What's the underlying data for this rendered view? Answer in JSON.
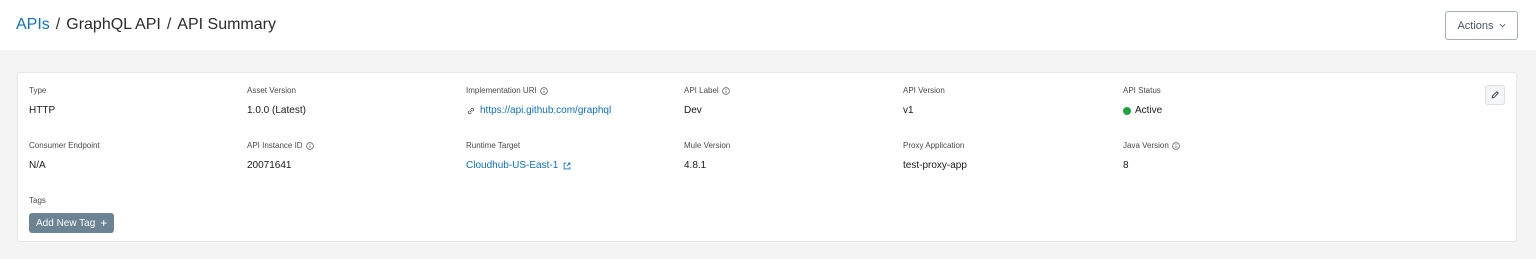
{
  "breadcrumb": {
    "root": "APIs",
    "separator": "/",
    "api": "GraphQL API",
    "page": "API Summary"
  },
  "actions": {
    "label": "Actions"
  },
  "details": {
    "type": {
      "label": "Type",
      "value": "HTTP"
    },
    "asset_version": {
      "label": "Asset Version",
      "value": "1.0.0 (Latest)"
    },
    "implementation_uri": {
      "label": "Implementation URI",
      "value": "https://api.github.com/graphql"
    },
    "api_label": {
      "label": "API Label",
      "value": "Dev"
    },
    "api_version": {
      "label": "API Version",
      "value": "v1"
    },
    "api_status": {
      "label": "API Status",
      "value": "Active",
      "color": "#23a143"
    },
    "consumer_endpoint": {
      "label": "Consumer Endpoint",
      "value": "N/A"
    },
    "api_instance_id": {
      "label": "API Instance ID",
      "value": "20071641"
    },
    "runtime_target": {
      "label": "Runtime Target",
      "value": "Cloudhub-US-East-1"
    },
    "mule_version": {
      "label": "Mule Version",
      "value": "4.8.1"
    },
    "proxy_application": {
      "label": "Proxy Application",
      "value": "test-proxy-app"
    },
    "java_version": {
      "label": "Java Version",
      "value": "8"
    }
  },
  "tags": {
    "label": "Tags",
    "add_label": "Add New Tag",
    "add_icon": "+"
  },
  "colors": {
    "link": "#0f6fba",
    "tag_button": "#6b8393",
    "active_status": "#23a143"
  },
  "icons": {
    "info": "info-icon",
    "link": "link-icon",
    "external": "external-link-icon",
    "edit": "pencil-icon",
    "chevron": "chevron-down-icon"
  }
}
